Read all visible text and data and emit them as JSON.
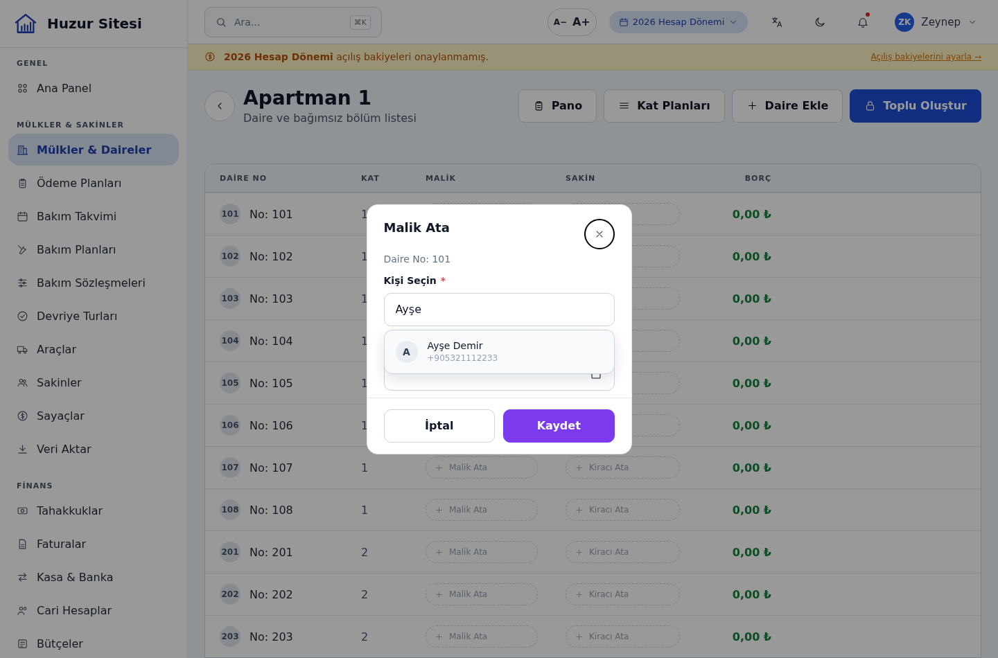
{
  "brand": {
    "name": "Huzur Sitesi"
  },
  "sidebar": {
    "sections": [
      {
        "title": "GENEL",
        "items": [
          {
            "label": "Ana Panel",
            "selected": false
          }
        ]
      },
      {
        "title": "MÜLKLER & SAKİNLER",
        "items": [
          {
            "label": "Mülkler & Daireler",
            "selected": true
          },
          {
            "label": "Ödeme Planları",
            "selected": false
          },
          {
            "label": "Bakım Takvimi",
            "selected": false
          },
          {
            "label": "Bakım Planları",
            "selected": false
          },
          {
            "label": "Bakım Sözleşmeleri",
            "selected": false
          },
          {
            "label": "Devriye Turları",
            "selected": false
          },
          {
            "label": "Araçlar",
            "selected": false
          },
          {
            "label": "Sakinler",
            "selected": false
          },
          {
            "label": "Sayaçlar",
            "selected": false
          },
          {
            "label": "Veri Aktar",
            "selected": false
          }
        ]
      },
      {
        "title": "FİNANS",
        "items": [
          {
            "label": "Tahakkuklar",
            "selected": false
          },
          {
            "label": "Faturalar",
            "selected": false
          },
          {
            "label": "Kasa & Banka",
            "selected": false
          },
          {
            "label": "Cari Hesaplar",
            "selected": false
          },
          {
            "label": "Bütçeler",
            "selected": false
          }
        ]
      }
    ]
  },
  "topbar": {
    "search": {
      "placeholder": "Ara...",
      "shortcut": "⌘K"
    },
    "font_size": {
      "decrease": "A−",
      "increase": "A+"
    },
    "period": "2026 Hesap Dönemi",
    "notifications_unread": true,
    "user": {
      "initials": "ZK",
      "name": "Zeynep"
    }
  },
  "banner": {
    "text": "**2026 Hesap Dönemi** açılış bakiyeleri onaylanmamış.",
    "link": "Açılış bakiyelerini ayarla →"
  },
  "page": {
    "title": "Apartman 1",
    "subtitle": "Daire ve bağımsız bölüm listesi",
    "actions": [
      {
        "label": "Pano",
        "primary": false
      },
      {
        "label": "Kat Planları",
        "primary": false
      },
      {
        "label": "Daire Ekle",
        "primary": false
      },
      {
        "label": "Toplu Oluştur",
        "primary": true
      }
    ]
  },
  "table": {
    "columns": [
      "DAİRE NO",
      "KAT",
      "MALİK",
      "SAKİN",
      "BORÇ"
    ],
    "rows": [
      {
        "badge": "101",
        "unit": "No: 101",
        "floor": "1",
        "balance": "0,00 ₺"
      },
      {
        "badge": "102",
        "unit": "No: 102",
        "floor": "1",
        "balance": "0,00 ₺"
      },
      {
        "badge": "103",
        "unit": "No: 103",
        "floor": "1",
        "balance": "0,00 ₺"
      },
      {
        "badge": "104",
        "unit": "No: 104",
        "floor": "1",
        "balance": "0,00 ₺"
      },
      {
        "badge": "105",
        "unit": "No: 105",
        "floor": "1",
        "balance": "0,00 ₺"
      },
      {
        "badge": "106",
        "unit": "No: 106",
        "floor": "1",
        "balance": "0,00 ₺"
      },
      {
        "badge": "107",
        "unit": "No: 107",
        "floor": "1",
        "owner": "Malik Ata",
        "tenant": "Kiracı Ata",
        "balance": "0,00 ₺"
      },
      {
        "badge": "108",
        "unit": "No: 108",
        "floor": "1",
        "owner": "Malik Ata",
        "tenant": "Kiracı Ata",
        "balance": "0,00 ₺"
      },
      {
        "badge": "201",
        "unit": "No: 201",
        "floor": "2",
        "owner": "Malik Ata",
        "tenant": "Kiracı Ata",
        "balance": "0,00 ₺"
      },
      {
        "badge": "202",
        "unit": "No: 202",
        "floor": "2",
        "owner": "Malik Ata",
        "tenant": "Kiracı Ata",
        "balance": "0,00 ₺"
      },
      {
        "badge": "203",
        "unit": "No: 203",
        "floor": "2",
        "owner": "Malik Ata",
        "tenant": "Kiracı Ata",
        "balance": "0,00 ₺"
      }
    ]
  },
  "dialog": {
    "title": "Malik Ata",
    "subtitle": "Daire No: 101",
    "field_label": "Kişi Seçin",
    "required": true,
    "required_mark": "*",
    "value": "Ayşe",
    "suggestions": [
      {
        "initial": "A",
        "name": "Ayşe Demir",
        "phone": "+905321112233"
      }
    ],
    "buttons": [
      {
        "label": "İptal",
        "primary": false
      },
      {
        "label": "Kaydet",
        "primary": true
      }
    ]
  }
}
